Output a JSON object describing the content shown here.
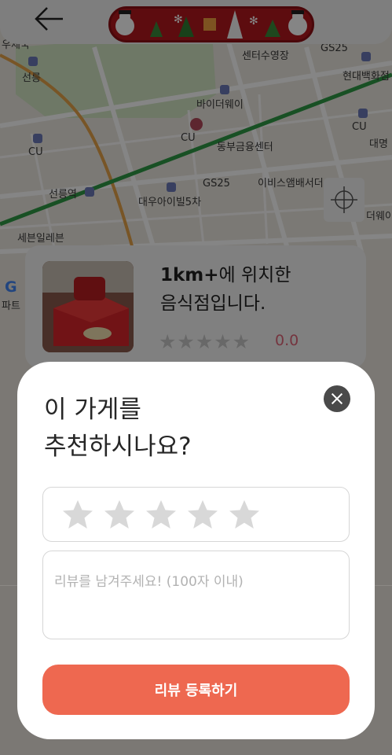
{
  "map": {
    "labels": [
      "우체국",
      "선릉",
      "센터수영장",
      "GS25",
      "현대백화점",
      "바이더웨이",
      "CU",
      "CU",
      "동부금융센터",
      "CU",
      "대명",
      "선릉역",
      "GS25",
      "이비스앰배서더",
      "대우아이빌5차",
      "세븐일레븐",
      "파트",
      "CU",
      "CU",
      "더웨이"
    ]
  },
  "header": {
    "back_icon": "arrow-left-icon",
    "banner_icon": "christmas-banner"
  },
  "store_card": {
    "distance": "1km+",
    "title_rest": "에 위치한",
    "title_line2": "음식점입니다.",
    "stars": "★★★★★",
    "rating": "0.0"
  },
  "review_modal": {
    "title": "이 가게를\n추천하시나요?",
    "close_icon": "close-icon",
    "star_count": 5,
    "selected_stars": 0,
    "review_placeholder": "리뷰를 남겨주세요! (100자 이내)",
    "review_value": "",
    "submit_label": "리뷰 등록하기"
  },
  "colors": {
    "accent": "#ee6850",
    "star_empty": "#d8d8d8",
    "rating_text": "#e0667a",
    "banner_red": "#b3181e"
  }
}
